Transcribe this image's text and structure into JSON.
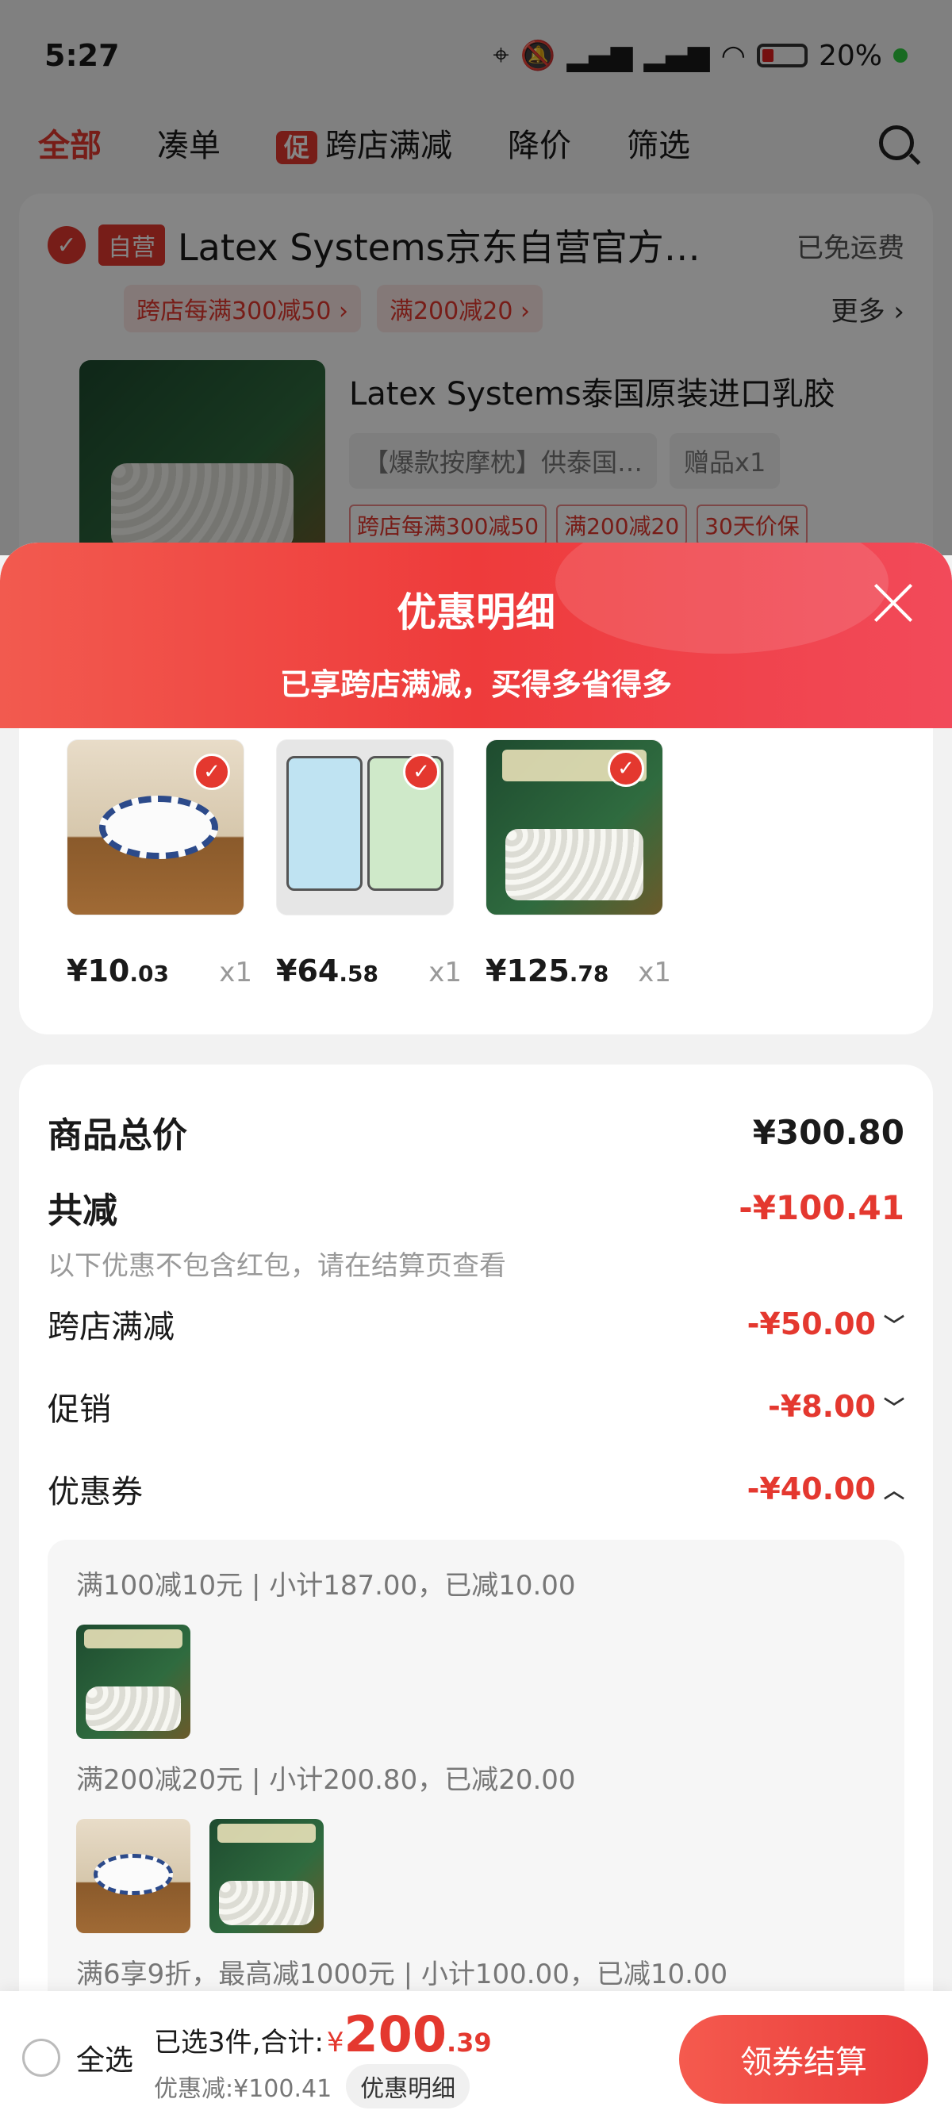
{
  "status_bar": {
    "time": "5:27",
    "battery": "20%"
  },
  "background": {
    "tabs": [
      "全部",
      "凑单",
      "跨店满减",
      "降价",
      "筛选"
    ],
    "promo_chip": "促",
    "store": {
      "badge": "自营",
      "name": "Latex Systems京东自营官方…",
      "shipping": "已免运费",
      "tags": [
        "跨店每满300减50 ›",
        "满200减20 ›"
      ],
      "more": "更多 ›"
    },
    "product": {
      "title": "Latex Systems泰国原装进口乳胶",
      "spec": "【爆款按摩枕】供泰国…",
      "gift": "赠品x1",
      "tags": [
        "跨店每满300减50",
        "满200减20",
        "30天价保"
      ]
    }
  },
  "sheet": {
    "title": "优惠明细",
    "subtitle": "已享跨店满减，买得多省得多",
    "items": [
      {
        "price_int": "¥10",
        "price_dec": ".03",
        "qty": "x1",
        "checked": true
      },
      {
        "price_int": "¥64",
        "price_dec": ".58",
        "qty": "x1",
        "checked": true
      },
      {
        "price_int": "¥125",
        "price_dec": ".78",
        "qty": "x1",
        "checked": true
      }
    ],
    "total_label": "商品总价",
    "total_value": "¥300.80",
    "reduce_label": "共减",
    "reduce_value": "-¥100.41",
    "note": "以下优惠不包含红包，请在结算页查看",
    "lines": [
      {
        "label": "跨店满减",
        "value": "-¥50.00",
        "expanded": false
      },
      {
        "label": "促销",
        "value": "-¥8.00",
        "expanded": false
      },
      {
        "label": "优惠券",
        "value": "-¥40.00",
        "expanded": true
      }
    ],
    "coupons": [
      "满100减10元 | 小计187.00，已减10.00",
      "满200减20元 | 小计200.80，已减20.00",
      "满6享9折，最高减1000元 | 小计100.00，已减10.00"
    ]
  },
  "bottom": {
    "select_all": "全选",
    "selected_text": "已选3件,合计:",
    "currency": "¥",
    "amount_int": "200",
    "amount_dec": ".39",
    "discount": "优惠减:¥100.41",
    "detail_chip": "优惠明细",
    "checkout": "领券结算"
  },
  "colors": {
    "accent": "#e4382f"
  }
}
